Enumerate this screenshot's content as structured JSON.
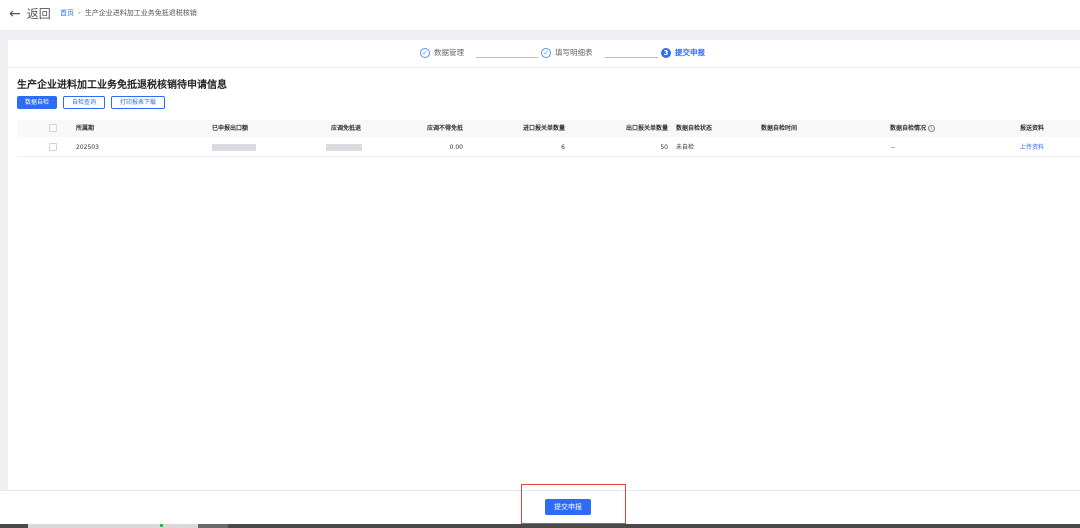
{
  "header": {
    "back_label": "返回",
    "breadcrumb": {
      "home": "首页",
      "separator": "›",
      "current": "生产企业进料加工业务免抵退税核销"
    }
  },
  "steps": [
    {
      "number": "✓",
      "label": "数据管理",
      "state": "done"
    },
    {
      "number": "✓",
      "label": "填写明细表",
      "state": "done"
    },
    {
      "number": "3",
      "label": "提交申报",
      "state": "active"
    }
  ],
  "page_title": "生产企业进料加工业务免抵退税核销待申请信息",
  "toolbar": {
    "check_label": "数据自检",
    "query_label": "自检查询",
    "print_label": "打印报表下载"
  },
  "table": {
    "columns": [
      "所属期",
      "已申报出口额",
      "应调免抵退",
      "应调不得免抵",
      "进口报关单数量",
      "出口报关单数量",
      "数据自检状态",
      "数据自检时间",
      "数据自检情况",
      "报送资料"
    ],
    "info_icon": "i",
    "rows": [
      {
        "period": "202503",
        "declared_export": "",
        "adjust_refund": "",
        "adjust_not_deduct": "0.00",
        "import_count": "6",
        "export_count": "50",
        "check_status": "未自检",
        "check_time": "",
        "check_result": "--",
        "materials_link": "上传资料"
      }
    ]
  },
  "footer": {
    "submit_label": "提交申报"
  },
  "colors": {
    "accent": "#2f6cf6",
    "highlight": "#e0463c"
  }
}
